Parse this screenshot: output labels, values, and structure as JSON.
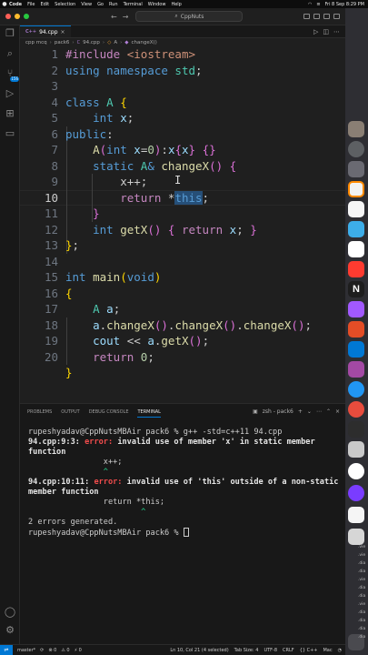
{
  "menubar": {
    "apple": "",
    "items": [
      "Code",
      "File",
      "Edit",
      "Selection",
      "View",
      "Go",
      "Run",
      "Terminal",
      "Window",
      "Help"
    ],
    "datetime": "Fri 8 Sep 8:29 PM"
  },
  "titlebar": {
    "back": "←",
    "forward": "→",
    "search": "CppNuts"
  },
  "tabs": {
    "active": {
      "lang": "C++",
      "name": "94.cpp",
      "close": "×"
    }
  },
  "breadcrumb": [
    "cpp mcq",
    "pack6",
    "94.cpp",
    "A",
    "changeX()"
  ],
  "activity": {
    "source_control_badge": "156"
  },
  "editor": {
    "line_numbers": [
      "1",
      "2",
      "3",
      "4",
      "5",
      "6",
      "7",
      "8",
      "9",
      "10",
      "11",
      "12",
      "13",
      "14",
      "15",
      "16",
      "17",
      "18",
      "19",
      "20"
    ],
    "current_line": 10
  },
  "panel": {
    "tabs": [
      "PROBLEMS",
      "OUTPUT",
      "DEBUG CONSOLE",
      "TERMINAL"
    ],
    "active_tab": "TERMINAL",
    "shell": "zsh - pack6",
    "terminal": {
      "prompt1": "rupeshyadav@CppNutsMBAir pack6 % ",
      "command": "g++ -std=c++11 94.cpp",
      "err1_loc": "94.cpp:9:3: ",
      "err1_label": "error: ",
      "err1_msg": "invalid use of member 'x' in static member function",
      "err1_src": "                x++;",
      "err1_caret": "                ^",
      "err2_loc": "94.cpp:10:11: ",
      "err2_label": "error: ",
      "err2_msg": "invalid use of 'this' outside of a non-static member function",
      "err2_src": "                return *this;",
      "err2_caret": "                        ^",
      "summary": "2 errors generated.",
      "prompt2": "rupeshyadav@CppNutsMBAir pack6 % "
    }
  },
  "statusbar": {
    "branch": "master*",
    "sync": "⟳",
    "errors": "⊗ 0",
    "warnings": "⚠ 0",
    "ports": "⚡ 0",
    "position": "Ln 10, Col 21 (4 selected)",
    "tab_size": "Tab Size: 4",
    "encoding": "UTF-8",
    "eol": "CRLF",
    "language": "{} C++",
    "platform": "Mac"
  },
  "dock": {
    "labels": [
      ".vie",
      ".vie",
      ".dia",
      ".dia",
      ".vie",
      ".dia",
      ".dia",
      ".vie",
      ".dia",
      ".dia",
      ".dia",
      ".dia"
    ]
  },
  "colors": {
    "accent": "#0078d4",
    "editor_bg": "#1f1f1f",
    "panel_bg": "#181818",
    "error": "#f14c4c"
  }
}
